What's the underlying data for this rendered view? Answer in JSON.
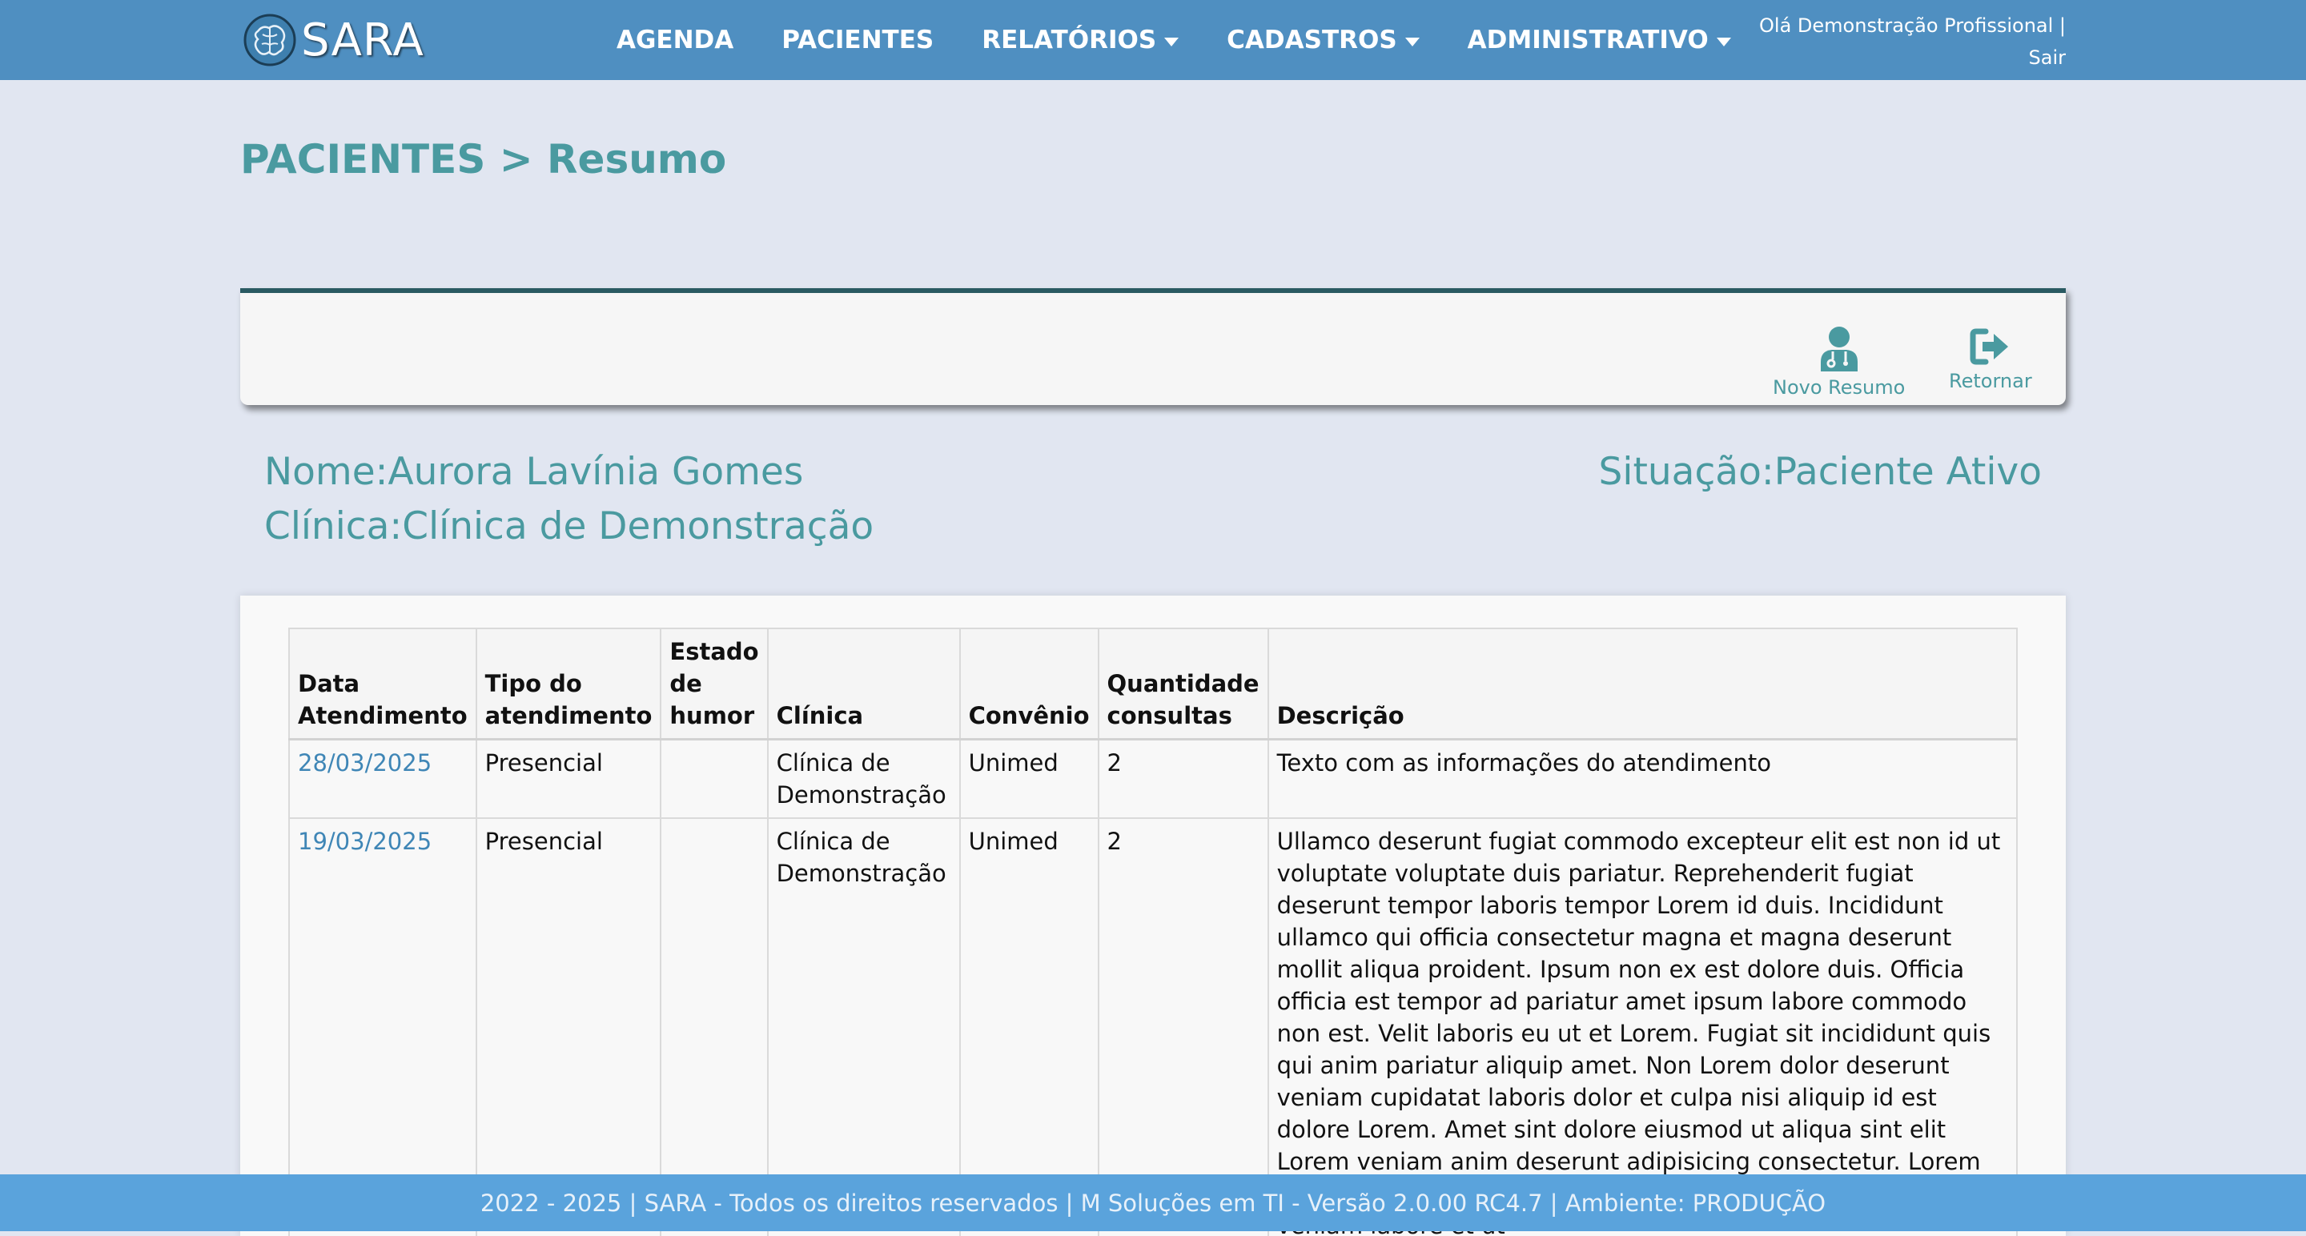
{
  "navbar": {
    "brand": "SARA",
    "menu": [
      {
        "label": "AGENDA",
        "dropdown": false
      },
      {
        "label": "PACIENTES",
        "dropdown": false
      },
      {
        "label": "RELATÓRIOS",
        "dropdown": true
      },
      {
        "label": "CADASTROS",
        "dropdown": true
      },
      {
        "label": "ADMINISTRATIVO",
        "dropdown": true
      }
    ],
    "user_greeting": "Olá Demonstração Profissional |",
    "logout_label": "Sair"
  },
  "page": {
    "title": "PACIENTES > Resumo"
  },
  "toolbar": {
    "novo_resumo_label": "Novo Resumo",
    "retornar_label": "Retornar"
  },
  "patient": {
    "nome": "Nome:Aurora Lavínia Gomes",
    "clinica": "Clínica:Clínica de Demonstração",
    "situacao": "Situação:Paciente Ativo"
  },
  "table": {
    "headers": {
      "data": "Data Atendimento",
      "tipo": "Tipo do atendimento",
      "humor": "Estado de humor",
      "clinica": "Clínica",
      "convenio": "Convênio",
      "quantidade": "Quantidade consultas",
      "descricao": "Descrição"
    },
    "rows": [
      {
        "data": "28/03/2025",
        "tipo": "Presencial",
        "humor": "",
        "clinica": "Clínica de Demonstração",
        "convenio": "Unimed",
        "quantidade": "2",
        "descricao": "Texto com as informações do atendimento"
      },
      {
        "data": "19/03/2025",
        "tipo": "Presencial",
        "humor": "",
        "clinica": "Clínica de Demonstração",
        "convenio": "Unimed",
        "quantidade": "2",
        "descricao": "Ullamco deserunt fugiat commodo excepteur elit est non id ut voluptate voluptate duis pariatur. Reprehenderit fugiat deserunt tempor laboris tempor Lorem id duis. Incididunt ullamco qui officia consectetur magna et magna deserunt mollit aliqua proident. Ipsum non ex est dolore duis. Officia officia est tempor ad pariatur amet ipsum labore commodo non est. Velit laboris eu ut et Lorem. Fugiat sit incididunt quis qui anim pariatur aliquip amet. Non Lorem dolor deserunt veniam cupidatat laboris dolor et culpa nisi aliquip id est dolore Lorem. Amet sint dolore eiusmod ut aliqua sint elit Lorem veniam anim deserunt adipisicing consectetur. Lorem minim ea est nulla aliqua non laborum magna eiusmod cillum veniam labore et ut"
      }
    ]
  },
  "footer": {
    "text": "2022 - 2025 | SARA - Todos os direitos reservados | M Soluções em TI - Versão 2.0.00 RC4.7 | Ambiente: PRODUÇÃO"
  },
  "colors": {
    "navbar": "#4f8fc1",
    "background": "#e1e6f1",
    "accent_teal": "#4a9aa0",
    "link": "#3f86b6",
    "footer": "#5aa3dc"
  },
  "icons": {
    "logo": "brain-icon",
    "novo_resumo": "doctor-icon",
    "retornar": "sign-out-icon",
    "dropdown": "caret-down-icon"
  }
}
